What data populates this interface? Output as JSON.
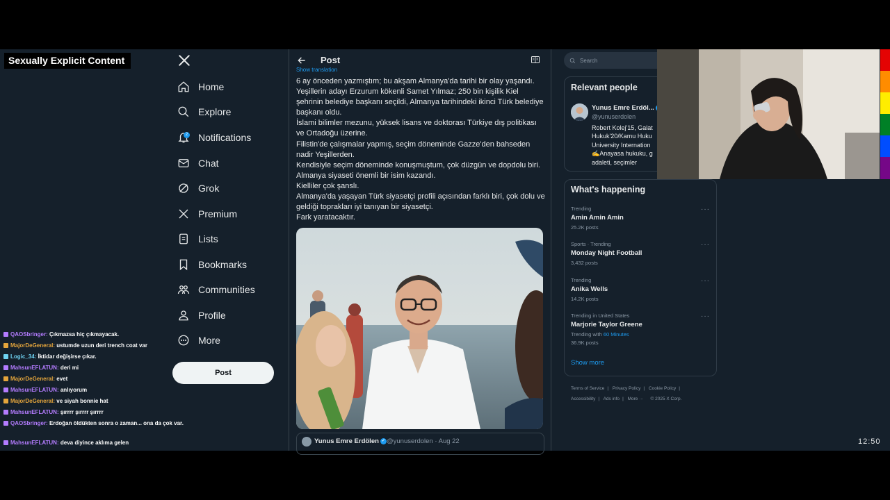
{
  "overlay": {
    "label": "Sexually Explicit Content"
  },
  "nav": {
    "items": [
      {
        "label": "Home"
      },
      {
        "label": "Explore"
      },
      {
        "label": "Notifications",
        "badge": "2"
      },
      {
        "label": "Chat"
      },
      {
        "label": "Grok"
      },
      {
        "label": "Premium"
      },
      {
        "label": "Lists"
      },
      {
        "label": "Bookmarks"
      },
      {
        "label": "Communities"
      },
      {
        "label": "Profile"
      },
      {
        "label": "More"
      }
    ],
    "post_button": "Post"
  },
  "chat": [
    {
      "user": "QAOSbringer:",
      "msg": "Çıkmazsa hiç çıkmayacak.",
      "color": "#b47cff"
    },
    {
      "user": "MajorDeGeneral:",
      "msg": "ustumde uzun deri trench coat var",
      "color": "#e4a53c"
    },
    {
      "user": "Logic_34:",
      "msg": "İktidar değişirse çıkar.",
      "color": "#6fd3f2"
    },
    {
      "user": "MahsunEFLATUN:",
      "msg": "deri mi",
      "color": "#b47cff"
    },
    {
      "user": "MajorDeGeneral:",
      "msg": "evet",
      "color": "#e4a53c"
    },
    {
      "user": "MahsunEFLATUN:",
      "msg": "anlıyorum",
      "color": "#b47cff"
    },
    {
      "user": "MajorDeGeneral:",
      "msg": "ve siyah bonnie hat",
      "color": "#e4a53c"
    },
    {
      "user": "MahsunEFLATUN:",
      "msg": "şırrrr şırrrr şırrrr",
      "color": "#b47cff"
    },
    {
      "user": "QAOSbringer:",
      "msg": "Erdoğan öldükten sonra o zaman... ona da çok var.",
      "color": "#b47cff"
    },
    {
      "user": "MahsunEFLATUN:",
      "msg": "deva diyince aklıma gelen",
      "color": "#b47cff"
    }
  ],
  "post": {
    "header_title": "Post",
    "show_translation": "Show translation",
    "text_lines": [
      "6 ay önceden yazmıştım; bu akşam Almanya'da tarihi bir olay yaşandı.",
      "Yeşillerin adayı Erzurum kökenli Samet Yılmaz; 250 bin kişilik Kiel şehrinin belediye başkanı seçildi, Almanya tarihindeki ikinci Türk belediye başkanı oldu.",
      "İslami bilimler mezunu, yüksek lisans ve doktorası Türkiye dış politikası ve Ortadoğu üzerine.",
      "Filistin'de çalışmalar yapmış, seçim döneminde Gazze'den bahseden nadir Yeşillerden.",
      "Kendisiyle seçim döneminde konuşmuştum, çok düzgün ve dopdolu biri.",
      "Almanya siyaseti önemli bir isim kazandı.",
      "Kielliler çok şanslı.",
      "Almanya'da yaşayan Türk siyasetçi profili açısından farklı biri, çok dolu ve geldiği toprakları iyi tanıyan bir siyasetçi.",
      "Fark yaratacaktır."
    ],
    "quote": {
      "name": "Yunus Emre Erdölen",
      "handle": "@yunuserdolen · Aug 22"
    }
  },
  "sidebar": {
    "search_placeholder": "Search",
    "relevant_title": "Relevant people",
    "person": {
      "name": "Yunus Emre Erdöl...",
      "handle": "@yunuserdolen",
      "bio_lines": [
        "Robert Kolej'15, Galat",
        "Hukuk'20/Kamu Huku",
        "University Internation",
        "✍️Anayasa hukuku, g",
        "adaleti, seçimler"
      ]
    },
    "happening_title": "What's happening",
    "trends": [
      {
        "meta": "Trending",
        "name": "Amin Amin Amin",
        "count": "25.2K posts"
      },
      {
        "meta": "Sports · Trending",
        "name": "Monday Night Football",
        "count": "3,432 posts"
      },
      {
        "meta": "Trending",
        "name": "Anika Wells",
        "count": "14.2K posts"
      },
      {
        "meta": "Trending in United States",
        "name": "Marjorie Taylor Greene",
        "count_prefix": "Trending with ",
        "count_link": "60 Minutes",
        "count": "36.9K posts"
      }
    ],
    "show_more": "Show more",
    "footer": {
      "links": [
        "Terms of Service",
        "Privacy Policy",
        "Cookie Policy",
        "Accessibility",
        "Ads info",
        "More ···"
      ],
      "copyright": "© 2025 X Corp."
    }
  },
  "clock": "12:50",
  "colors": {
    "background": "#15202b",
    "accent": "#1d9bf0",
    "border": "#38444d"
  }
}
